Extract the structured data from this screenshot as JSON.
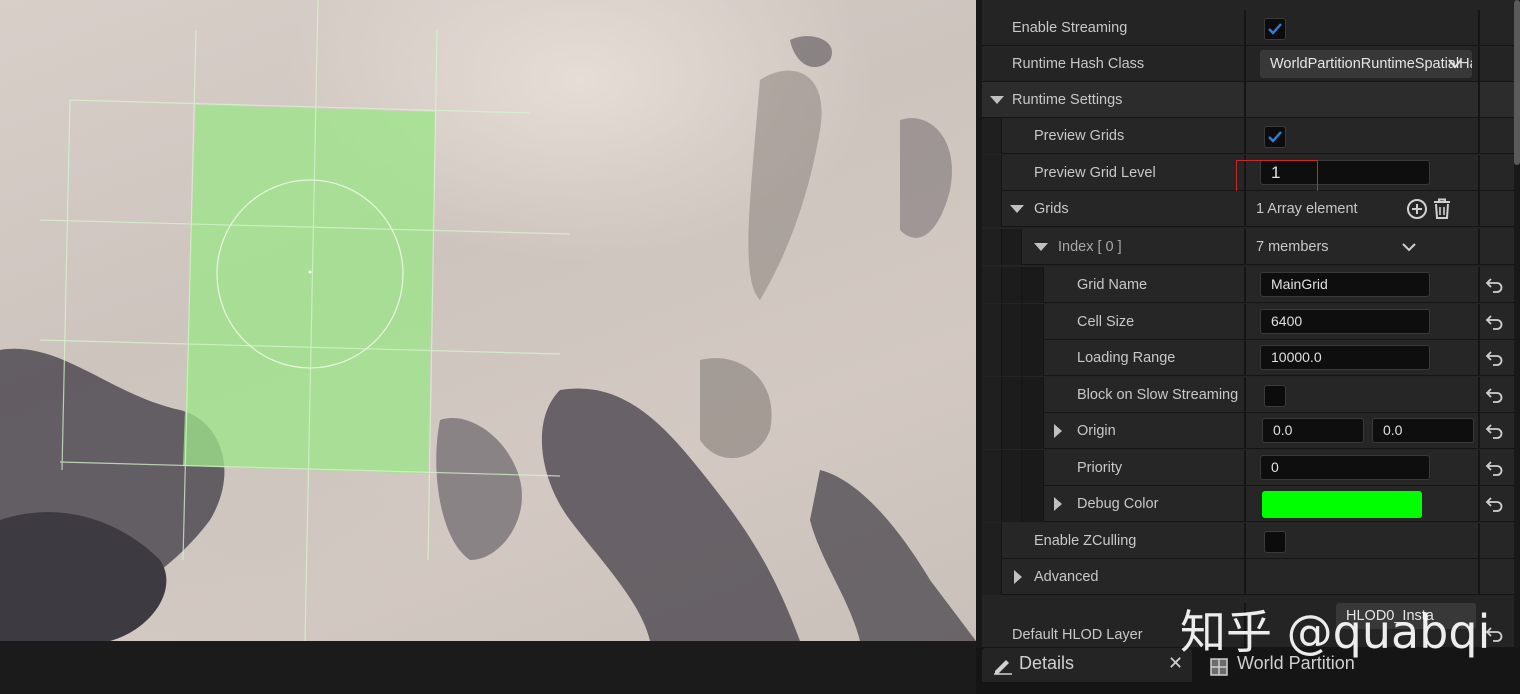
{
  "details": {
    "rows": {
      "enable_streaming": {
        "label": "Enable Streaming",
        "checked": true
      },
      "runtime_hash_class": {
        "label": "Runtime Hash Class",
        "value": "WorldPartitionRuntimeSpatialHash"
      },
      "runtime_settings": {
        "label": "Runtime Settings"
      },
      "preview_grids": {
        "label": "Preview Grids",
        "checked": true
      },
      "preview_grid_level": {
        "label": "Preview Grid Level",
        "value": "1"
      },
      "grids": {
        "label": "Grids",
        "value": "1 Array element"
      },
      "index0": {
        "label": "Index [ 0 ]",
        "value": "7 members"
      },
      "grid_name": {
        "label": "Grid Name",
        "value": "MainGrid"
      },
      "cell_size": {
        "label": "Cell Size",
        "value": "6400"
      },
      "loading_range": {
        "label": "Loading Range",
        "value": "10000.0"
      },
      "block_on_slow_streaming": {
        "label": "Block on Slow Streaming",
        "checked": false
      },
      "origin": {
        "label": "Origin",
        "x": "0.0",
        "y": "0.0"
      },
      "priority": {
        "label": "Priority",
        "value": "0"
      },
      "debug_color": {
        "label": "Debug Color",
        "color": "#00ff00"
      },
      "enable_zculling": {
        "label": "Enable ZCulling",
        "checked": false
      },
      "advanced": {
        "label": "Advanced"
      },
      "default_hlod_layer": {
        "label": "Default HLOD Layer",
        "value": "HLOD0_Insta"
      }
    }
  },
  "tabs": {
    "details": "Details",
    "world_partition": "World Partition"
  },
  "watermark": "知乎 @quabqi",
  "colors": {
    "accent_check": "#2f7fd8",
    "highlight_box": "#c8282a",
    "grid_overlay": "#9de48b"
  }
}
